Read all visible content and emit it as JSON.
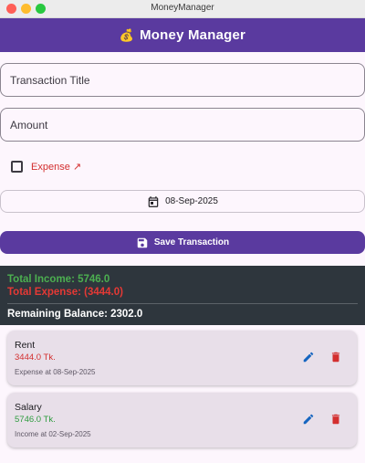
{
  "window": {
    "title": "MoneyManager"
  },
  "appbar": {
    "emoji": "💰",
    "title": "Money Manager"
  },
  "form": {
    "title_placeholder": "Transaction Title",
    "amount_placeholder": "Amount",
    "type_checkbox": {
      "checked": false
    },
    "type_label": "Expense",
    "type_arrow": "↗",
    "date_label": "08-Sep-2025",
    "save_label": "Save Transaction"
  },
  "summary": {
    "income": "Total Income: 5746.0",
    "expense": "Total Expense: (3444.0)",
    "balance": "Remaining Balance: 2302.0"
  },
  "transactions": [
    {
      "title": "Rent",
      "amount": "3444.0 Tk.",
      "meta": "Expense at 08-Sep-2025",
      "kind": "expense"
    },
    {
      "title": "Salary",
      "amount": "5746.0 Tk.",
      "meta": "Income at 02-Sep-2025",
      "kind": "income"
    }
  ],
  "colors": {
    "primary": "#5a3a9f",
    "expense": "#d32f2f",
    "income": "#2e9c3f",
    "summary_bg": "#2e363d",
    "edit_icon": "#1565c0"
  },
  "icons": {
    "calendar": "calendar-icon",
    "save": "save-icon",
    "edit": "edit-icon",
    "delete": "delete-icon"
  }
}
